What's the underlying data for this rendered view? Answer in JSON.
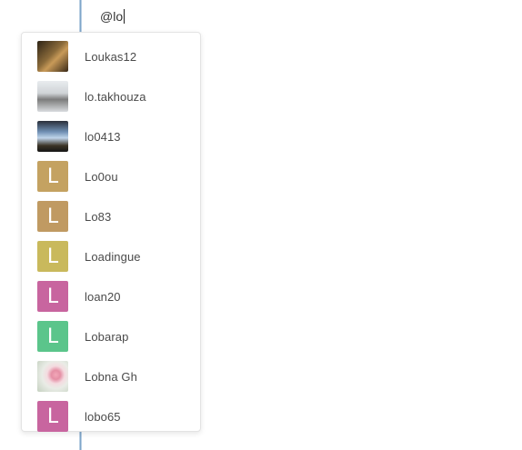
{
  "composer": {
    "text": "@lo"
  },
  "mentions": [
    {
      "username": "Loukas12",
      "avatar": {
        "type": "photo",
        "icon": "user-photo-icon"
      }
    },
    {
      "username": "lo.takhouza",
      "avatar": {
        "type": "photo",
        "icon": "user-photo-icon"
      }
    },
    {
      "username": "lo0413",
      "avatar": {
        "type": "photo",
        "icon": "user-photo-icon"
      }
    },
    {
      "username": "Lo0ou",
      "avatar": {
        "type": "letter",
        "letter": "L",
        "color": "#c4a261"
      }
    },
    {
      "username": "Lo83",
      "avatar": {
        "type": "letter",
        "letter": "L",
        "color": "#c09a62"
      }
    },
    {
      "username": "Loadingue",
      "avatar": {
        "type": "letter",
        "letter": "L",
        "color": "#c9b95c"
      }
    },
    {
      "username": "loan20",
      "avatar": {
        "type": "letter",
        "letter": "L",
        "color": "#c8659f"
      }
    },
    {
      "username": "Lobarap",
      "avatar": {
        "type": "letter",
        "letter": "L",
        "color": "#5bc58b"
      }
    },
    {
      "username": "Lobna Gh",
      "avatar": {
        "type": "photo",
        "icon": "user-photo-icon"
      }
    },
    {
      "username": "lobo65",
      "avatar": {
        "type": "letter",
        "letter": "L",
        "color": "#c8659f"
      }
    }
  ],
  "colors": {
    "editor_rule": "#7fa6c9",
    "popup_border": "#e3e3e3",
    "text": "#4a4a4a"
  }
}
